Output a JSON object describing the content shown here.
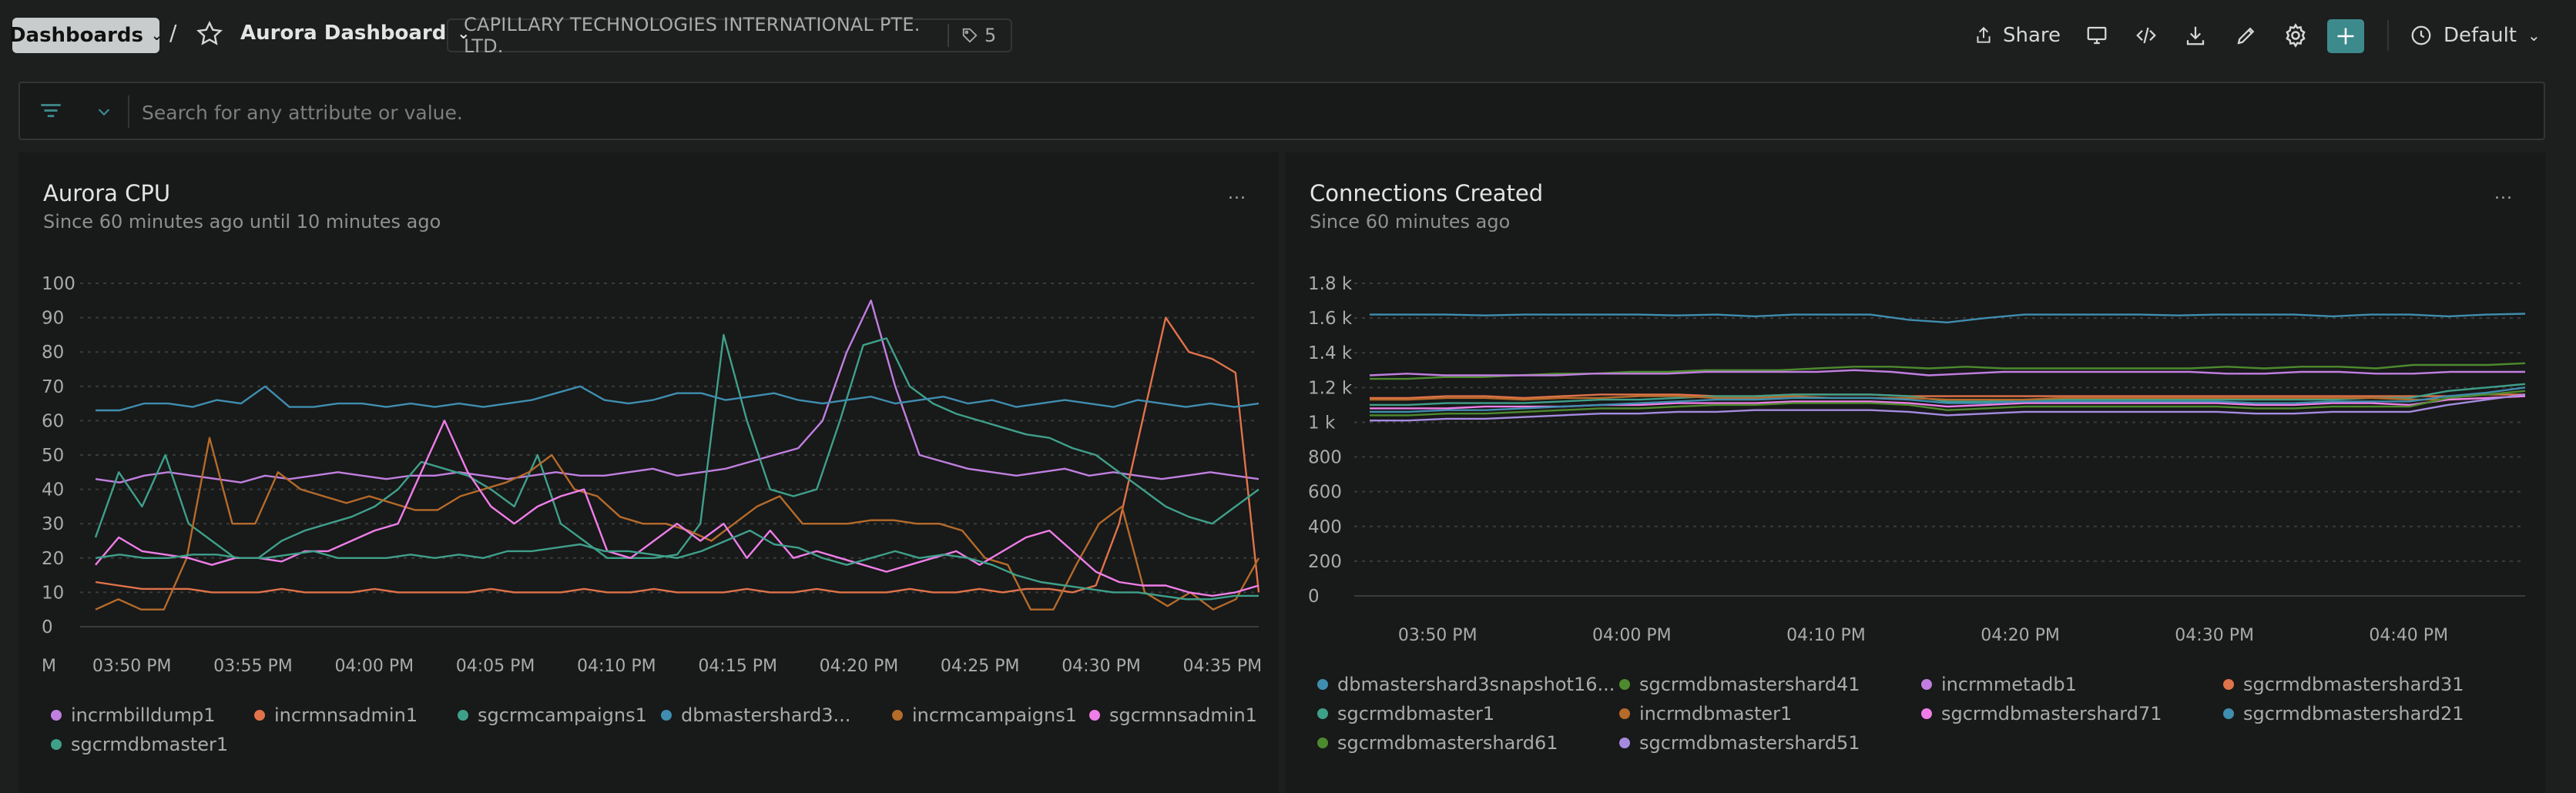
{
  "topbar": {
    "dashboards_label": "Dashboards",
    "separator": "/",
    "dashboard_title": "Aurora Dashboard",
    "account_name": "CAPILLARY TECHNOLOGIES INTERNATIONAL PTE. LTD.",
    "tag_count": "5",
    "share_label": "Share",
    "default_label": "Default"
  },
  "filter": {
    "placeholder": "Search for any attribute or value."
  },
  "colors": {
    "accent": "#3d8a8d",
    "purple": "#c07fe0",
    "orange": "#e0734a",
    "teal": "#3fa08a",
    "blue": "#3f8eb0",
    "brown": "#b56b2a",
    "pink": "#ef7ee8",
    "green": "#4d8a2e",
    "lavender": "#a48be0"
  },
  "panels": [
    {
      "title": "Aurora CPU",
      "subtitle": "Since 60 minutes ago until 10 minutes ago",
      "menu_label": "...",
      "legend": [
        {
          "name": "incrmbilldump1",
          "color": "#c07fe0"
        },
        {
          "name": "incrmnsadmin1",
          "color": "#e0734a"
        },
        {
          "name": "sgcrmcampaigns1",
          "color": "#3fa08a"
        },
        {
          "name": "dbmastershard3...",
          "color": "#3f8eb0"
        },
        {
          "name": "incrmcampaigns1",
          "color": "#b56b2a"
        },
        {
          "name": "sgcrmnsadmin1",
          "color": "#ef7ee8"
        },
        {
          "name": "sgcrmdbmaster1",
          "color": "#3fa08a"
        }
      ]
    },
    {
      "title": "Connections Created",
      "subtitle": "Since 60 minutes ago",
      "menu_label": "...",
      "legend": [
        {
          "name": "dbmastershard3snapshot16...",
          "color": "#3f8eb0"
        },
        {
          "name": "sgcrmdbmastershard41",
          "color": "#4d8a2e"
        },
        {
          "name": "incrmmetadb1",
          "color": "#c07fe0"
        },
        {
          "name": "sgcrmdbmastershard31",
          "color": "#e0734a"
        },
        {
          "name": "sgcrmdbmaster1",
          "color": "#3fa08a"
        },
        {
          "name": "incrmdbmaster1",
          "color": "#b56b2a"
        },
        {
          "name": "sgcrmdbmastershard71",
          "color": "#ef7ee8"
        },
        {
          "name": "sgcrmdbmastershard21",
          "color": "#3f8eb0"
        },
        {
          "name": "sgcrmdbmastershard61",
          "color": "#4d8a2e"
        },
        {
          "name": "sgcrmdbmastershard51",
          "color": "#a48be0"
        }
      ]
    }
  ],
  "chart_data": [
    {
      "type": "line",
      "title": "Aurora CPU",
      "subtitle": "Since 60 minutes ago until 10 minutes ago",
      "ylim": [
        0,
        100
      ],
      "yticks": [
        "100",
        "90",
        "80",
        "70",
        "60",
        "50",
        "40",
        "30",
        "20",
        "10",
        "0"
      ],
      "xticks": [
        "03:50 PM",
        "03:55 PM",
        "04:00 PM",
        "04:05 PM",
        "04:10 PM",
        "04:15 PM",
        "04:20 PM",
        "04:25 PM",
        "04:30 PM",
        "04:35 PM"
      ],
      "x_first_partial_label": "M",
      "x_minutes": [
        -1.5,
        46.5
      ],
      "grid": true,
      "legend_position": "bottom",
      "series": [
        {
          "name": "incrmbilldump1",
          "color": "#c07fe0",
          "values": [
            43,
            42,
            44,
            45,
            44,
            43,
            42,
            44,
            43,
            44,
            45,
            44,
            43,
            44,
            44,
            45,
            44,
            43,
            44,
            45,
            44,
            44,
            45,
            46,
            44,
            45,
            46,
            48,
            50,
            52,
            60,
            80,
            95,
            70,
            50,
            48,
            46,
            45,
            44,
            45,
            46,
            44,
            45,
            44,
            43,
            44,
            45,
            44,
            43
          ]
        },
        {
          "name": "incrmnsadmin1",
          "color": "#e0734a",
          "values": [
            13,
            12,
            11,
            11,
            11,
            10,
            10,
            10,
            11,
            10,
            10,
            10,
            11,
            10,
            10,
            10,
            10,
            11,
            10,
            10,
            10,
            11,
            10,
            10,
            11,
            10,
            10,
            10,
            11,
            10,
            10,
            11,
            10,
            10,
            10,
            11,
            10,
            10,
            11,
            10,
            11,
            11,
            10,
            12,
            30,
            60,
            90,
            80,
            78,
            74,
            10
          ]
        },
        {
          "name": "sgcrmcampaigns1",
          "color": "#3fa08a",
          "values": [
            26,
            45,
            35,
            50,
            30,
            25,
            20,
            20,
            25,
            28,
            30,
            32,
            35,
            40,
            48,
            46,
            44,
            40,
            35,
            50,
            30,
            25,
            20,
            20,
            20,
            21,
            30,
            85,
            60,
            40,
            38,
            40,
            60,
            82,
            84,
            70,
            65,
            62,
            60,
            58,
            56,
            55,
            52,
            50,
            45,
            40,
            35,
            32,
            30,
            35,
            40
          ]
        },
        {
          "name": "dbmastershard3...",
          "color": "#3f8eb0",
          "values": [
            63,
            63,
            65,
            65,
            64,
            66,
            65,
            70,
            64,
            64,
            65,
            65,
            64,
            65,
            64,
            65,
            64,
            65,
            66,
            68,
            70,
            66,
            65,
            66,
            68,
            68,
            66,
            67,
            68,
            66,
            65,
            66,
            67,
            65,
            66,
            67,
            65,
            66,
            64,
            65,
            66,
            65,
            64,
            66,
            65,
            64,
            65,
            64,
            65
          ]
        },
        {
          "name": "incrmcampaigns1",
          "color": "#b56b2a",
          "values": [
            5,
            8,
            5,
            5,
            20,
            55,
            30,
            30,
            45,
            40,
            38,
            36,
            38,
            36,
            34,
            34,
            38,
            40,
            42,
            45,
            50,
            40,
            38,
            32,
            30,
            30,
            28,
            25,
            30,
            35,
            38,
            30,
            30,
            30,
            31,
            31,
            30,
            30,
            28,
            20,
            18,
            5,
            5,
            18,
            30,
            35,
            10,
            6,
            10,
            5,
            8,
            20
          ]
        },
        {
          "name": "sgcrmnsadmin1",
          "color": "#ef7ee8",
          "values": [
            18,
            26,
            22,
            21,
            20,
            18,
            20,
            20,
            19,
            22,
            22,
            25,
            28,
            30,
            45,
            60,
            45,
            35,
            30,
            35,
            38,
            40,
            22,
            20,
            25,
            30,
            25,
            30,
            20,
            28,
            20,
            22,
            20,
            18,
            16,
            18,
            20,
            22,
            18,
            22,
            26,
            28,
            22,
            16,
            13,
            12,
            12,
            10,
            9,
            10,
            12
          ]
        },
        {
          "name": "sgcrmdbmaster1",
          "color": "#3fa08a",
          "values": [
            20,
            21,
            20,
            20,
            21,
            21,
            20,
            20,
            21,
            22,
            20,
            20,
            20,
            21,
            20,
            21,
            20,
            22,
            22,
            23,
            24,
            22,
            22,
            21,
            20,
            22,
            25,
            28,
            24,
            23,
            20,
            18,
            20,
            22,
            20,
            21,
            20,
            18,
            15,
            13,
            12,
            11,
            10,
            10,
            9,
            8,
            8,
            9,
            9
          ]
        }
      ]
    },
    {
      "type": "line",
      "title": "Connections Created",
      "subtitle": "Since 60 minutes ago",
      "ylim": [
        0,
        1800
      ],
      "yticks": [
        "1.8 k",
        "1.6 k",
        "1.4 k",
        "1.2 k",
        "1 k",
        "800",
        "600",
        "400",
        "200",
        "0"
      ],
      "xticks": [
        "03:50 PM",
        "04:00 PM",
        "04:10 PM",
        "04:20 PM",
        "04:30 PM",
        "04:40 PM"
      ],
      "x_minutes": [
        -3.5,
        56
      ],
      "grid": true,
      "legend_position": "bottom",
      "series": [
        {
          "name": "dbmastershard3snapshot16...",
          "color": "#3f8eb0",
          "values": [
            1620,
            1620,
            1620,
            1615,
            1620,
            1620,
            1620,
            1620,
            1615,
            1620,
            1610,
            1620,
            1620,
            1620,
            1590,
            1575,
            1600,
            1620,
            1620,
            1620,
            1620,
            1615,
            1620,
            1620,
            1620,
            1610,
            1620,
            1620,
            1610,
            1620,
            1625
          ]
        },
        {
          "name": "sgcrmdbmastershard41",
          "color": "#4d8a2e",
          "values": [
            1250,
            1250,
            1260,
            1260,
            1270,
            1280,
            1280,
            1290,
            1290,
            1300,
            1300,
            1300,
            1310,
            1320,
            1320,
            1310,
            1320,
            1310,
            1310,
            1310,
            1310,
            1310,
            1310,
            1320,
            1310,
            1320,
            1320,
            1310,
            1330,
            1330,
            1330,
            1340
          ]
        },
        {
          "name": "incrmmetadb1",
          "color": "#c07fe0",
          "values": [
            1270,
            1280,
            1270,
            1270,
            1270,
            1270,
            1280,
            1280,
            1280,
            1290,
            1290,
            1290,
            1290,
            1300,
            1290,
            1270,
            1280,
            1290,
            1290,
            1290,
            1290,
            1290,
            1290,
            1280,
            1280,
            1290,
            1290,
            1280,
            1280,
            1290,
            1290,
            1290
          ]
        },
        {
          "name": "sgcrmdbmastershard31",
          "color": "#e0734a",
          "values": [
            1140,
            1140,
            1150,
            1150,
            1140,
            1150,
            1160,
            1160,
            1160,
            1150,
            1150,
            1160,
            1160,
            1160,
            1150,
            1150,
            1150,
            1150,
            1150,
            1150,
            1150,
            1150,
            1150,
            1150,
            1150,
            1150,
            1150,
            1150,
            1150,
            1160,
            1160
          ]
        },
        {
          "name": "sgcrmdbmaster1",
          "color": "#3fa08a",
          "values": [
            1100,
            1100,
            1110,
            1110,
            1110,
            1120,
            1130,
            1130,
            1140,
            1150,
            1150,
            1160,
            1160,
            1160,
            1150,
            1120,
            1120,
            1130,
            1130,
            1130,
            1130,
            1130,
            1130,
            1130,
            1130,
            1130,
            1140,
            1140,
            1180,
            1200,
            1220
          ]
        },
        {
          "name": "incrmdbmaster1",
          "color": "#b56b2a",
          "values": [
            1130,
            1130,
            1140,
            1140,
            1130,
            1140,
            1140,
            1150,
            1150,
            1140,
            1140,
            1150,
            1140,
            1140,
            1140,
            1130,
            1130,
            1130,
            1140,
            1140,
            1140,
            1140,
            1140,
            1140,
            1140,
            1140,
            1140,
            1130,
            1130,
            1140,
            1150
          ]
        },
        {
          "name": "sgcrmdbmastershard71",
          "color": "#ef7ee8",
          "values": [
            1080,
            1080,
            1080,
            1090,
            1090,
            1090,
            1100,
            1100,
            1110,
            1110,
            1110,
            1120,
            1120,
            1120,
            1110,
            1090,
            1100,
            1110,
            1110,
            1110,
            1110,
            1110,
            1110,
            1100,
            1100,
            1110,
            1110,
            1100,
            1130,
            1140,
            1150
          ]
        },
        {
          "name": "sgcrmdbmastershard21",
          "color": "#3f8eb0",
          "values": [
            1060,
            1060,
            1070,
            1070,
            1080,
            1090,
            1100,
            1110,
            1120,
            1130,
            1130,
            1140,
            1140,
            1140,
            1130,
            1110,
            1110,
            1120,
            1120,
            1120,
            1120,
            1120,
            1120,
            1110,
            1110,
            1120,
            1120,
            1120,
            1150,
            1170,
            1200
          ]
        },
        {
          "name": "sgcrmdbmastershard61",
          "color": "#4d8a2e",
          "values": [
            1040,
            1040,
            1050,
            1050,
            1060,
            1070,
            1080,
            1080,
            1090,
            1100,
            1100,
            1110,
            1110,
            1110,
            1100,
            1070,
            1080,
            1090,
            1090,
            1090,
            1090,
            1090,
            1090,
            1080,
            1080,
            1090,
            1090,
            1090,
            1140,
            1160,
            1180
          ]
        },
        {
          "name": "sgcrmdbmastershard51",
          "color": "#a48be0",
          "values": [
            1010,
            1010,
            1020,
            1020,
            1030,
            1040,
            1050,
            1050,
            1060,
            1060,
            1070,
            1070,
            1070,
            1070,
            1060,
            1040,
            1050,
            1060,
            1060,
            1060,
            1060,
            1060,
            1060,
            1050,
            1050,
            1060,
            1060,
            1060,
            1100,
            1130,
            1160
          ]
        }
      ]
    }
  ]
}
